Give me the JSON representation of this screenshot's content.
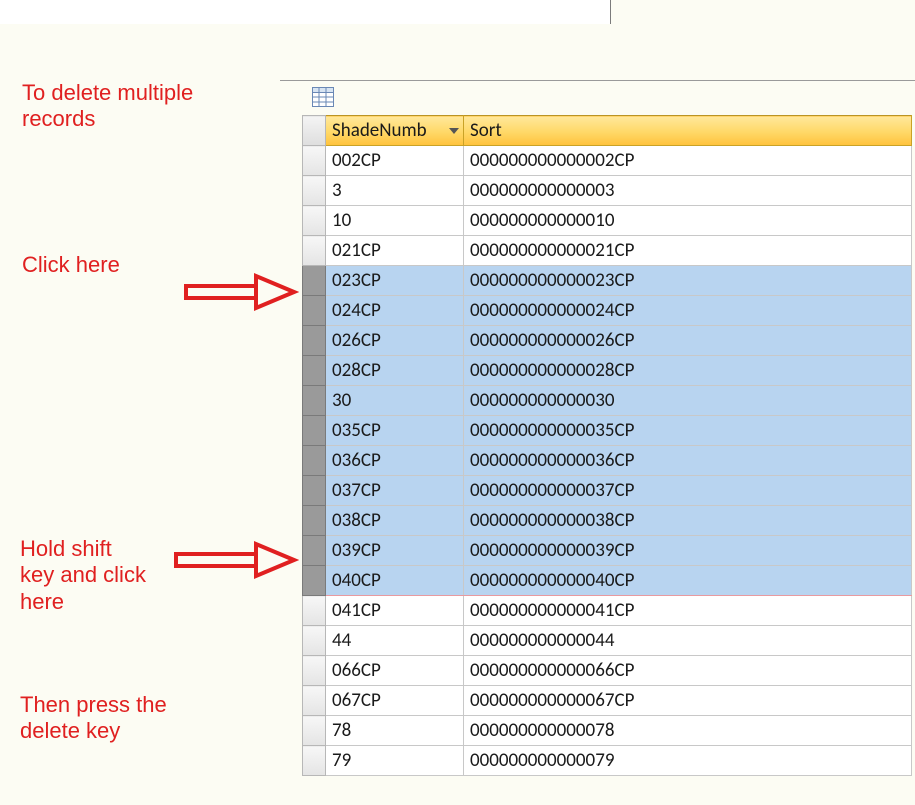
{
  "annotations": {
    "title": "To delete multiple\nrecords",
    "click_here": "Click here",
    "hold_shift": "Hold shift\nkey and click\nhere",
    "then_delete": "Then press the\ndelete key"
  },
  "header": {
    "col1": "ShadeNumb",
    "col2": "Sort"
  },
  "rows": [
    {
      "a": "002CP",
      "b": "000000000000002CP",
      "selected": false
    },
    {
      "a": "3",
      "b": "000000000000003",
      "selected": false
    },
    {
      "a": "10",
      "b": "000000000000010",
      "selected": false
    },
    {
      "a": "021CP",
      "b": "000000000000021CP",
      "selected": false
    },
    {
      "a": "023CP",
      "b": "000000000000023CP",
      "selected": true
    },
    {
      "a": "024CP",
      "b": "000000000000024CP",
      "selected": true
    },
    {
      "a": "026CP",
      "b": "000000000000026CP",
      "selected": true
    },
    {
      "a": "028CP",
      "b": "000000000000028CP",
      "selected": true
    },
    {
      "a": "30",
      "b": "000000000000030",
      "selected": true
    },
    {
      "a": "035CP",
      "b": "000000000000035CP",
      "selected": true
    },
    {
      "a": "036CP",
      "b": "000000000000036CP",
      "selected": true
    },
    {
      "a": "037CP",
      "b": "000000000000037CP",
      "selected": true
    },
    {
      "a": "038CP",
      "b": "000000000000038CP",
      "selected": true
    },
    {
      "a": "039CP",
      "b": "000000000000039CP",
      "selected": true
    },
    {
      "a": "040CP",
      "b": "000000000000040CP",
      "selected": true
    },
    {
      "a": "041CP",
      "b": "000000000000041CP",
      "selected": false
    },
    {
      "a": "44",
      "b": "000000000000044",
      "selected": false
    },
    {
      "a": "066CP",
      "b": "000000000000066CP",
      "selected": false
    },
    {
      "a": "067CP",
      "b": "000000000000067CP",
      "selected": false
    },
    {
      "a": "78",
      "b": "000000000000078",
      "selected": false
    },
    {
      "a": "79",
      "b": "000000000000079",
      "selected": false
    }
  ]
}
